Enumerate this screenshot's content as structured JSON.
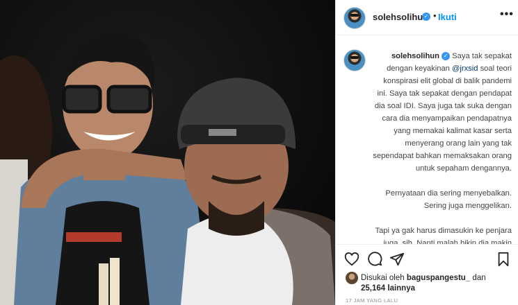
{
  "post": {
    "username": "solehsolihun",
    "follow_label": "Ikuti",
    "dot": "•",
    "more": "•••"
  },
  "caption": {
    "username": "solehsolihun",
    "text_before_mention": " Saya tak sepakat dengan keyakinan ",
    "mention": "@jrxsid",
    "text_after_mention": " soal teori konspirasi elit global di balik pandemi ini. Saya tak sepakat dengan pendapat dia soal IDI. Saya juga tak suka dengan cara dia menyampaikan pendapatnya yang memakai kalimat kasar serta menyerang orang lain yang tak sependapat bahkan memaksakan orang untuk sepaham dengannya.",
    "paragraph_2": "Pernyataan dia sering menyebalkan. Sering juga menggelikan.",
    "paragraph_3": "Tapi ya gak harus dimasukin ke penjara juga, sih. Nanti malah bikin dia makin merasa benar. Nanti pengikutnya jadi menganggap dia pahlawan. Padahal, kan dia sudah"
  },
  "likes": {
    "prefix": "Disukai oleh ",
    "user": "baguspangestu_",
    "connector": " dan",
    "count": "25,164 lainnya"
  },
  "timestamp": "17 JAM YANG LALU",
  "icons": {
    "like": "heart-icon",
    "comment": "comment-icon",
    "share": "paper-plane-icon",
    "save": "bookmark-icon",
    "verified": "verified-badge-icon"
  },
  "colors": {
    "link": "#0095f6",
    "verified": "#3897f0",
    "mention": "#00376b"
  }
}
